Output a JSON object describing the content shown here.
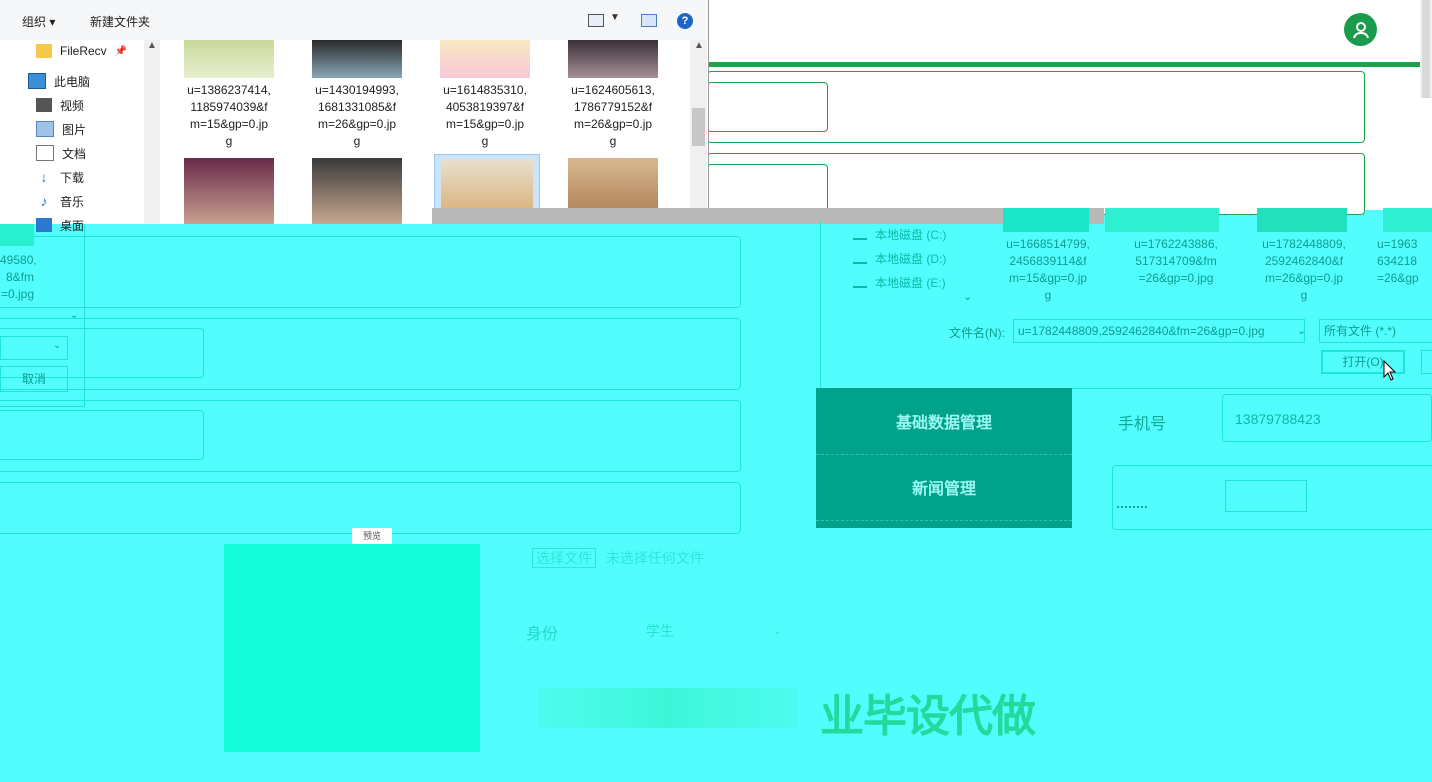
{
  "explorer": {
    "toolbar": {
      "organize_label": "组织",
      "new_folder_label": "新建文件夹",
      "help_glyph": "?"
    },
    "nav": {
      "items": [
        {
          "label": "FileRecv",
          "icon": "folder-icon"
        },
        {
          "label": "此电脑",
          "icon": "computer-icon"
        },
        {
          "label": "视频",
          "icon": "video-icon"
        },
        {
          "label": "图片",
          "icon": "picture-icon"
        },
        {
          "label": "文档",
          "icon": "document-icon"
        },
        {
          "label": "下载",
          "icon": "download-icon"
        },
        {
          "label": "音乐",
          "icon": "music-icon"
        },
        {
          "label": "桌面",
          "icon": "desktop-icon"
        }
      ]
    },
    "files": [
      {
        "name": "u=1386237414,1185974039 8&fm=15&gp=0.jp g",
        "label": "u=1386237414,\n1185974039 8&f\nm=15&gp=0.jp\ng"
      },
      {
        "name": "u=1430194993",
        "label": "u=1430194993,\n1681331085&f\nm=26&gp=0.jp\ng"
      },
      {
        "name": "u=1614835310",
        "label": "u=1614835310,\n4053819397&f\nm=15&gp=0.jp\ng"
      },
      {
        "name": "u=1624605613",
        "label": "u=1624605613,\n1786779152&f\nm=26&gp=0.jp\ng"
      }
    ],
    "file_captions": [
      [
        "u=1386237414,",
        "1185974039&f",
        "m=15&gp=0.jp",
        "g"
      ],
      [
        "u=1430194993,",
        "1681331085&f",
        "m=26&gp=0.jp",
        "g"
      ],
      [
        "u=1614835310,",
        "4053819397&f",
        "m=15&gp=0.jp",
        "g"
      ],
      [
        "u=1624605613,",
        "1786779152&f",
        "m=26&gp=0.jp",
        "g"
      ]
    ]
  },
  "left_dialog": {
    "caption": [
      "49580,",
      "8&fm",
      "=0.jpg"
    ],
    "cancel_label": "取消"
  },
  "file_dialog": {
    "drives": [
      "本地磁盘 (C:)",
      "本地磁盘 (D:)",
      "本地磁盘 (E:)"
    ],
    "captions": [
      [
        "u=1668514799,",
        "2456839114&f",
        "m=15&gp=0.jp",
        "g"
      ],
      [
        "u=1762243886,",
        "517314709&fm",
        "=26&gp=0.jpg"
      ],
      [
        "u=1782448809,",
        "2592462840&f",
        "m=26&gp=0.jp",
        "g"
      ],
      [
        "u=1963",
        "634218",
        "=26&gp"
      ]
    ],
    "filename_label": "文件名(N):",
    "filename_value": "u=1782448809,2592462840&fm=26&gp=0.jpg",
    "filetype_value": "所有文件 (*.*)",
    "open_label": "打开(O)"
  },
  "menu": {
    "items": [
      "基础数据管理",
      "新闻管理"
    ]
  },
  "form": {
    "phone_label": "手机号",
    "phone_value": "13879788423",
    "file_choose_label": "选择文件",
    "file_none_label": "未选择任何文件",
    "identity_label": "身份",
    "identity_value": "学生",
    "preview_tag": "预览"
  },
  "watermark": {
    "text": "业毕设代做"
  },
  "colors": {
    "green": "#1aa34a",
    "cyan_bg": "#52fefd",
    "teal_menu": "#00a28a"
  }
}
